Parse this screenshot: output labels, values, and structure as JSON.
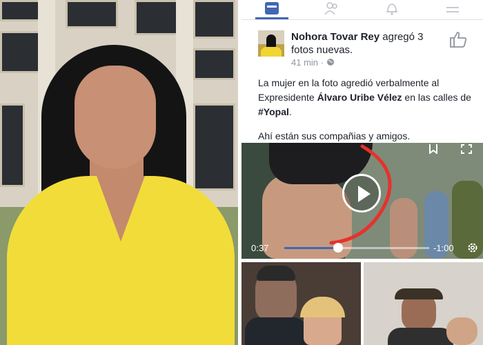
{
  "post": {
    "author": "Nohora Tovar Rey",
    "action_line1": " agregó 3",
    "action_line2": "fotos nuevas.",
    "time": "41 min",
    "separator": "·",
    "text_line1": "La mujer en la foto agredió verbalmente al",
    "text_line2_pre": "Expresidente ",
    "text_line2_bold": "Álvaro Uribe Vélez",
    "text_line2_post": " en las calles de",
    "text_line3_bold": "#Yopal",
    "text_line3_post": ".",
    "text_para2": "Ahí están sus compañias y amigos."
  },
  "video": {
    "time_elapsed": "0:37",
    "time_remaining": "-1:00",
    "progress": 0.37
  },
  "nav": {
    "icons": [
      "news-feed-icon",
      "friends-icon",
      "notifications-icon",
      "menu-icon"
    ]
  },
  "colors": {
    "facebook_blue": "#4267b2",
    "shirt_yellow": "#f2dc3a",
    "annotation_red": "#e5322d"
  }
}
